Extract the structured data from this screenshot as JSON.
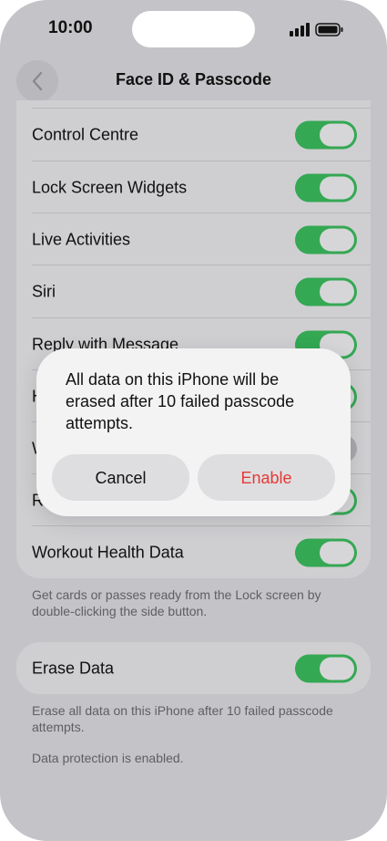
{
  "status_bar": {
    "time": "10:00"
  },
  "nav": {
    "title": "Face ID & Passcode",
    "back_icon": "chevron-left-icon"
  },
  "settings": {
    "rows": [
      {
        "label": "Control Centre",
        "enabled": true
      },
      {
        "label": "Lock Screen Widgets",
        "enabled": true
      },
      {
        "label": "Live Activities",
        "enabled": true
      },
      {
        "label": "Siri",
        "enabled": true
      },
      {
        "label": "Reply with Message",
        "enabled": true
      },
      {
        "label": "H",
        "enabled": true
      },
      {
        "label": "W",
        "enabled": false
      },
      {
        "label": "R",
        "enabled": true
      },
      {
        "label": "Workout Health Data",
        "enabled": true
      }
    ],
    "wallet_footer": "Get cards or passes ready from the Lock screen by double-clicking the side button."
  },
  "erase": {
    "label": "Erase Data",
    "enabled": true,
    "footer": "Erase all data on this iPhone after 10 failed passcode attempts.",
    "protection": "Data protection is enabled."
  },
  "alert": {
    "message": "All data on this iPhone will be erased after 10 failed passcode attempts.",
    "cancel": "Cancel",
    "enable": "Enable"
  },
  "colors": {
    "toggle_on": "#34a853",
    "destructive": "#e53935"
  }
}
